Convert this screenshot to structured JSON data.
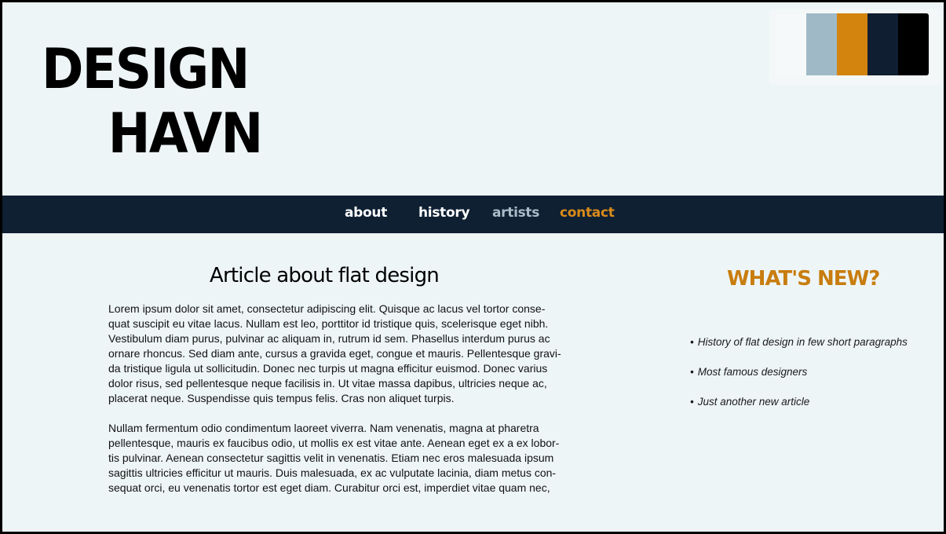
{
  "logo": {
    "line1": "DESIGN",
    "line2": "HAVN"
  },
  "palette": {
    "colors": [
      "#f5f9fa",
      "#9fbac6",
      "#d3840f",
      "#0f1e30",
      "#000000"
    ]
  },
  "nav": {
    "items": [
      {
        "label": "about",
        "color": "#ffffff"
      },
      {
        "label": "history",
        "color": "#ffffff"
      },
      {
        "label": "artists",
        "color": "#a9bcc7"
      },
      {
        "label": "contact",
        "color": "#d88b1b"
      }
    ]
  },
  "article": {
    "title": "Article about flat design",
    "paragraphs": [
      [
        "Lorem ipsum dolor sit amet, consectetur adipiscing elit. Quisque ac lacus vel tortor conse-",
        "quat suscipit eu vitae lacus. Nullam est leo, porttitor id tristique quis, scelerisque eget nibh.",
        "Vestibulum diam purus, pulvinar ac aliquam in, rutrum id sem. Phasellus interdum purus ac",
        "ornare rhoncus. Sed diam ante, cursus a gravida eget, congue et mauris. Pellentesque gravi-",
        "da tristique ligula ut sollicitudin. Donec nec turpis ut magna efficitur euismod. Donec varius",
        "dolor risus, sed pellentesque neque facilisis in. Ut vitae massa dapibus, ultricies neque ac,",
        "placerat neque. Suspendisse quis tempus felis. Cras non aliquet turpis."
      ],
      [
        "Nullam fermentum odio condimentum laoreet viverra. Nam venenatis, magna at pharetra",
        "pellentesque, mauris ex faucibus odio, ut mollis ex est vitae ante. Aenean eget ex a ex lobor-",
        "tis pulvinar. Aenean consectetur sagittis velit in venenatis. Etiam nec eros malesuada ipsum",
        "sagittis ultricies efficitur ut mauris. Duis malesuada, ex ac vulputate lacinia, diam metus con-",
        "sequat orci, eu venenatis tortor est eget diam. Curabitur orci est, imperdiet vitae quam nec,"
      ]
    ]
  },
  "sidebar": {
    "title": "WHAT'S NEW?",
    "items": [
      "History of flat design in few short paragraphs",
      "Most famous designers",
      "Just another new article"
    ]
  }
}
